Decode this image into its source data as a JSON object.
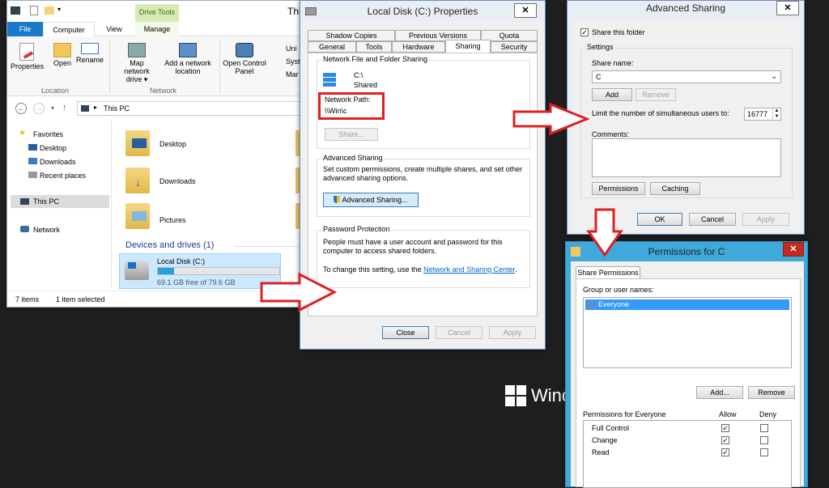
{
  "explorer": {
    "title_fragment": "Thi",
    "ribbon_tabs": [
      "File",
      "Computer",
      "View",
      "Manage"
    ],
    "context_tab": "Drive Tools",
    "location_items": [
      "Properties",
      "Open",
      "Rename"
    ],
    "network_items": [
      "Map network drive ▾",
      "Add a network location"
    ],
    "system_items": [
      "Open Control Panel"
    ],
    "sys_fragments": [
      "Uni",
      "Syst",
      "Mar"
    ],
    "group_labels": [
      "Location",
      "Network"
    ],
    "address": "This PC",
    "favorites_header": "Favorites",
    "favorites": [
      "Desktop",
      "Downloads",
      "Recent places"
    ],
    "this_pc": "This PC",
    "network": "Network",
    "folders": [
      "Desktop",
      "Downloads",
      "Pictures"
    ],
    "devices_header": "Devices and drives (1)",
    "drive_name": "Local Disk (C:)",
    "drive_free": "69.1 GB free of 79.6 GB",
    "drive_used_fraction": 0.13,
    "status_items": "7 items",
    "status_selected": "1 item selected"
  },
  "props": {
    "title": "Local Disk (C:) Properties",
    "tabs_row1": [
      "Shadow Copies",
      "Previous Versions",
      "Quota"
    ],
    "tabs_row2": [
      "General",
      "Tools",
      "Hardware",
      "Sharing",
      "Security"
    ],
    "net_group_title": "Network File and Folder Sharing",
    "path_line1": "C:\\",
    "path_line2": "Shared",
    "network_path_label": "Network Path:",
    "network_path_value": "\\\\Win\\c",
    "share_button": "Share...",
    "adv_group_title": "Advanced Sharing",
    "adv_desc": "Set custom permissions, create multiple shares, and set other advanced sharing options.",
    "adv_button": "Advanced Sharing...",
    "pw_group_title": "Password Protection",
    "pw_desc": "People must have a user account and password for this computer to access shared folders.",
    "pw_change_prefix": "To change this setting, use the ",
    "pw_link": "Network and Sharing Center",
    "pw_change_suffix": ".",
    "close": "Close",
    "cancel": "Cancel",
    "apply": "Apply"
  },
  "adv": {
    "title": "Advanced Sharing",
    "share_folder_label": "Share this folder",
    "settings_label": "Settings",
    "share_name_label": "Share name:",
    "share_name_value": "C",
    "add": "Add",
    "remove": "Remove",
    "limit_label": "Limit the number of simultaneous users to:",
    "limit_value": "16777",
    "comments_label": "Comments:",
    "permissions": "Permissions",
    "caching": "Caching",
    "ok": "OK",
    "cancel": "Cancel",
    "apply": "Apply"
  },
  "perm": {
    "title": "Permissions for C",
    "tab": "Share Permissions",
    "group_label": "Group or user names:",
    "users": [
      "Everyone"
    ],
    "add": "Add...",
    "remove": "Remove",
    "perm_header": "Permissions for Everyone",
    "allow": "Allow",
    "deny": "Deny",
    "rows": [
      {
        "name": "Full Control"
      },
      {
        "name": "Change"
      },
      {
        "name": "Read"
      }
    ]
  },
  "desktop": {
    "windows_text": "Wind"
  },
  "colors": {
    "annotation_red": "#e02020",
    "selection_blue": "#3399ff",
    "file_tab_blue": "#1979ca"
  }
}
